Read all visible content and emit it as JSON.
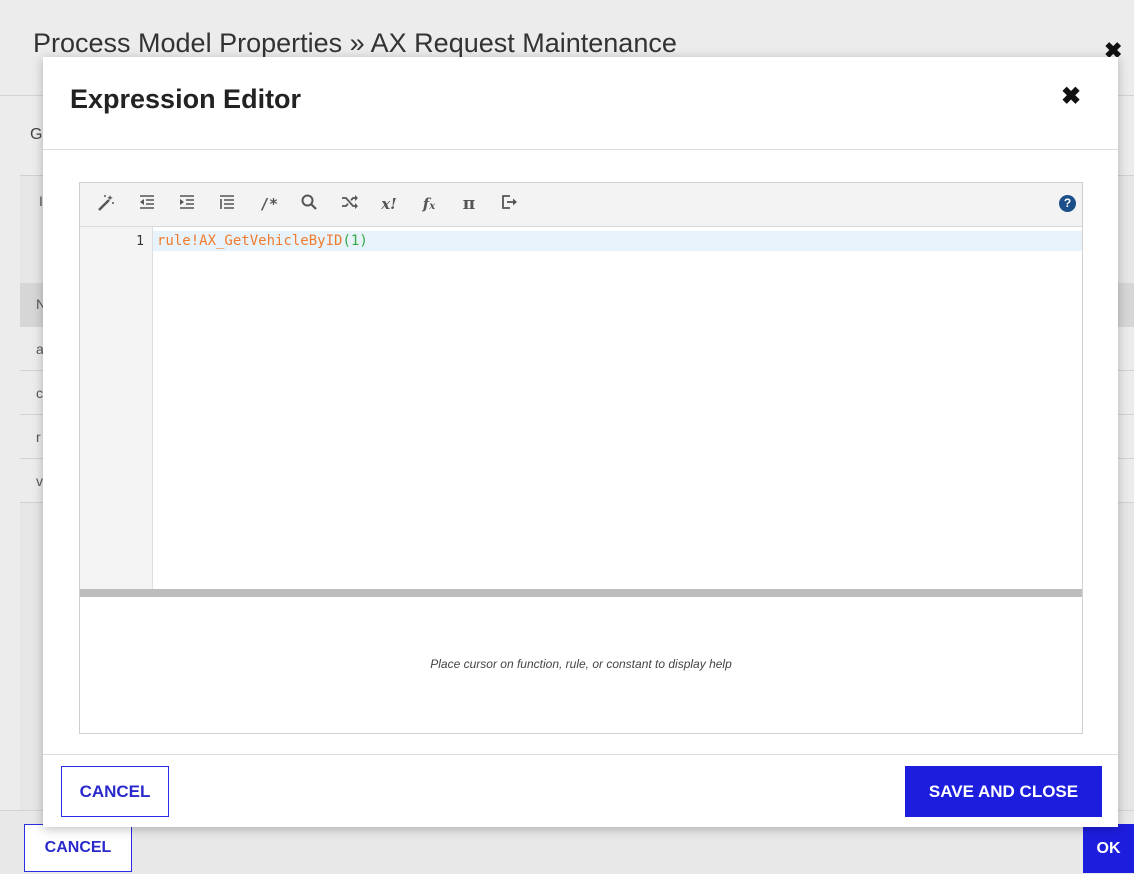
{
  "background": {
    "title": "Process Model Properties » AX Request Maintenance",
    "close_label": "✖",
    "tab_label": "G",
    "panel_header": "I",
    "table_header": "N",
    "rows": [
      "a",
      "c",
      "r",
      "v"
    ],
    "cancel_label": "CANCEL",
    "ok_label": "OK"
  },
  "modal": {
    "title": "Expression Editor",
    "close_label": "✖",
    "toolbar": {
      "icons": [
        "magic-wand-icon",
        "outdent-icon",
        "indent-icon",
        "format-list-icon",
        "comment-icon",
        "search-icon",
        "shuffle-icon",
        "exclamation-icon",
        "function-icon",
        "pi-icon",
        "export-icon"
      ],
      "help_label": "?"
    },
    "editor": {
      "line_number": "1",
      "code_rule": "rule!AX_GetVehicleByID",
      "code_open": "(",
      "code_arg": "1",
      "code_close": ")"
    },
    "help_text": "Place cursor on function, rule, or constant to display help",
    "cancel_label": "CANCEL",
    "save_label": "SAVE AND CLOSE"
  },
  "colors": {
    "primary_button": "#1d1dde",
    "outline_button": "#2c2ce6",
    "code_rule": "#f07b2d",
    "code_literal": "#33aa44",
    "help_icon": "#1c4f8a"
  }
}
